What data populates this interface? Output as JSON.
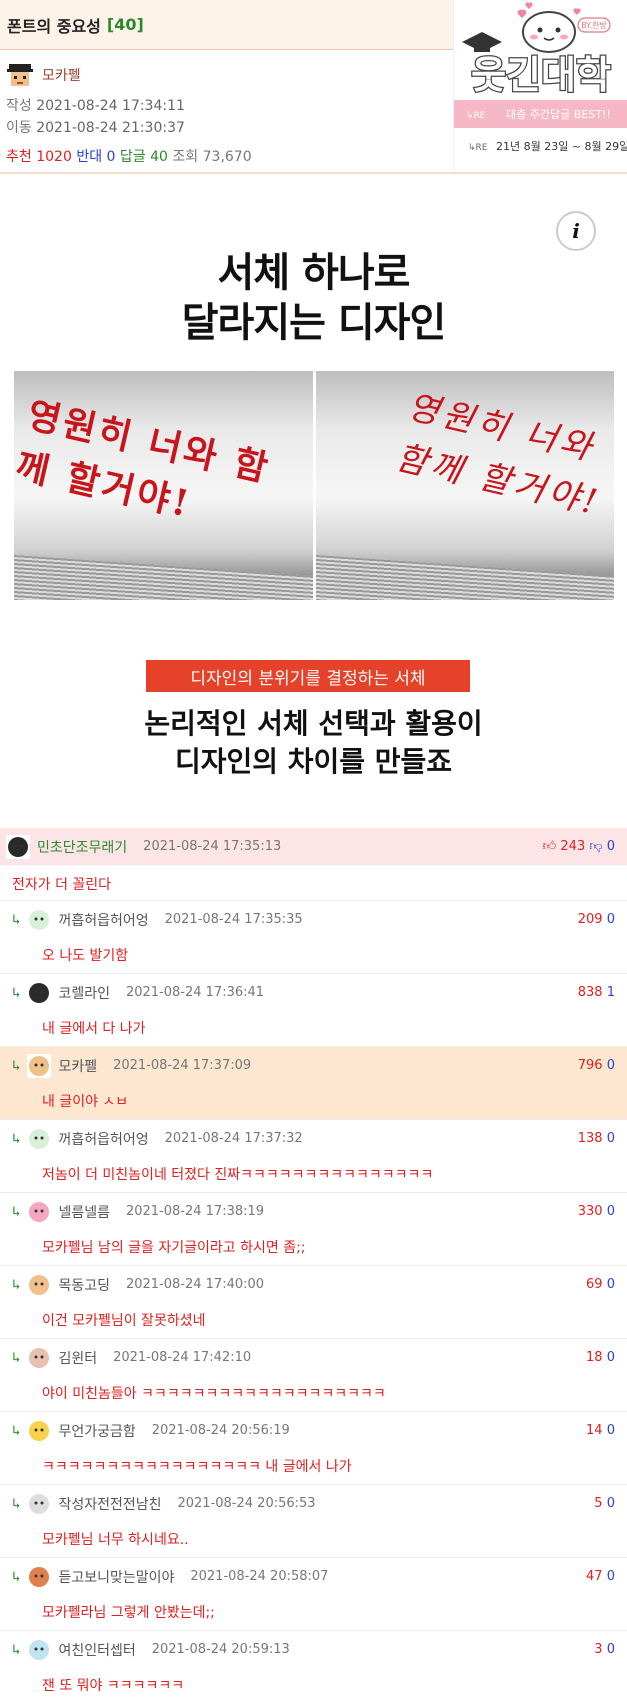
{
  "post": {
    "title": "폰트의 중요성",
    "comment_count": "[40]",
    "author": "모카펠",
    "created_label": "작성",
    "created": "2021-08-24 17:34:11",
    "moved_label": "이동",
    "moved": "2021-08-24 21:30:37",
    "recommend_label": "추천",
    "recommend": "1020",
    "oppose_label": "반대",
    "oppose": "0",
    "reply_label": "답글",
    "reply": "40",
    "views_label": "조회",
    "views": "73,670"
  },
  "logo": {
    "badge": "BY.한방",
    "title": "웃긴대학",
    "subtitle_prefix": "↳RE",
    "subtitle": "대충 주간답글 BEST!!",
    "range_prefix": "↳RE",
    "range": "21년 8월 23일 ~ 8월 29일"
  },
  "article": {
    "info": "i",
    "headline_1": "서체 하나로",
    "headline_2": "달라지는 디자인",
    "left_text": "영원히 너와 함께 할거야!",
    "right_text": "영원히 너와 함께 할거야!",
    "banner": "디자인의 분위기를 결정하는 서체",
    "caption_1": "논리적인 서체 선택과 활용이",
    "caption_2": "디자인의 차이를 만들죠"
  },
  "comments": [
    {
      "nick": "민초단조무래기",
      "date": "2021-08-24 17:35:13",
      "up": "243",
      "down": "0",
      "body": "전자가 더 꼴린다"
    },
    {
      "nick": "꺼흡허읍허어엉",
      "date": "2021-08-24 17:35:35",
      "up": "209",
      "down": "0",
      "body": "오 나도 발기함"
    },
    {
      "nick": "코렐라인",
      "date": "2021-08-24 17:36:41",
      "up": "838",
      "down": "1",
      "body": "내 글에서 다 나가"
    },
    {
      "nick": "모카펠",
      "date": "2021-08-24 17:37:09",
      "up": "796",
      "down": "0",
      "body": "내 글이야 ㅅㅂ"
    },
    {
      "nick": "꺼흡허읍허어엉",
      "date": "2021-08-24 17:37:32",
      "up": "138",
      "down": "0",
      "body": "저놈이 더 미친놈이네 터졌다 진짜ㅋㅋㅋㅋㅋㅋㅋㅋㅋㅋㅋㅋㅋㅋㅋ"
    },
    {
      "nick": "넬름넬름",
      "date": "2021-08-24 17:38:19",
      "up": "330",
      "down": "0",
      "body": "모카펠님 남의 글을 자기글이라고 하시면 좀;;"
    },
    {
      "nick": "목동고딩",
      "date": "2021-08-24 17:40:00",
      "up": "69",
      "down": "0",
      "body": "이건 모카펠님이 잘못하셨네"
    },
    {
      "nick": "김윈터",
      "date": "2021-08-24 17:42:10",
      "up": "18",
      "down": "0",
      "body": "야이 미친놈들아 ㅋㅋㅋㅋㅋㅋㅋㅋㅋㅋㅋㅋㅋㅋㅋㅋㅋㅋㅋ"
    },
    {
      "nick": "무언가궁금함",
      "date": "2021-08-24 20:56:19",
      "up": "14",
      "down": "0",
      "body": "ㅋㅋㅋㅋㅋㅋㅋㅋㅋㅋㅋㅋㅋㅋㅋㅋㅋ 내 글에서 나가"
    },
    {
      "nick": "작성자전전전남친",
      "date": "2021-08-24 20:56:53",
      "up": "5",
      "down": "0",
      "body": "모카펠님 너무 하시네요.."
    },
    {
      "nick": "듣고보니맞는말이야",
      "date": "2021-08-24 20:58:07",
      "up": "47",
      "down": "0",
      "body": "모카펠라님 그렇게 안봤는데;;"
    },
    {
      "nick": "여친인터셉터",
      "date": "2021-08-24 20:59:13",
      "up": "3",
      "down": "0",
      "body": "잰 또 뭐야 ㅋㅋㅋㅋㅋㅋ"
    }
  ],
  "colors": {
    "accent_red": "#e02020",
    "accent_blue": "#2a3fd8",
    "accent_green": "#2b8a2b",
    "title_bg": "#fdf3e9",
    "top_comment_bg": "#fde4e6",
    "author_comment_bg": "#fde7d1",
    "banner": "#e64129"
  }
}
